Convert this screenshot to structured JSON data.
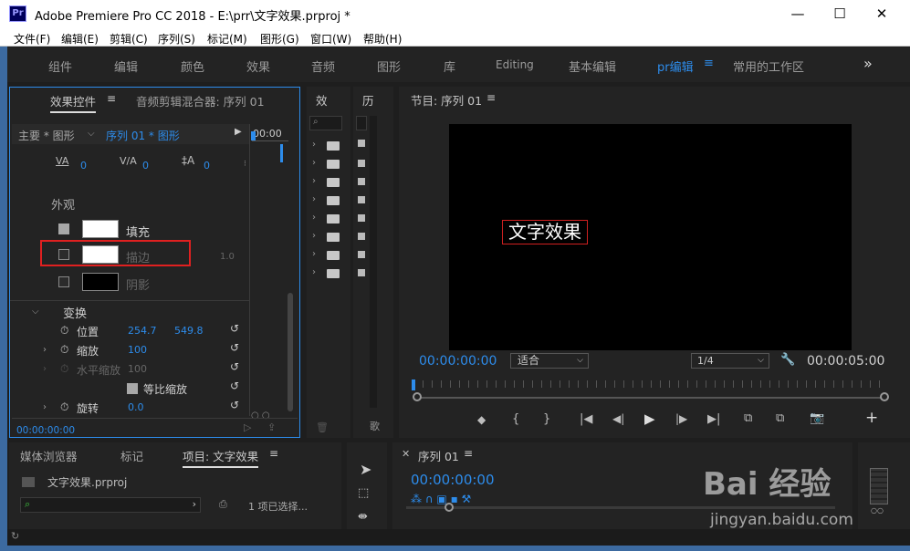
{
  "window": {
    "app_icon": "Pr",
    "title": "Adobe Premiere Pro CC 2018 - E:\\prr\\文字效果.prproj *",
    "min": "—",
    "max": "☐",
    "close": "✕"
  },
  "menu": [
    "文件(F)",
    "编辑(E)",
    "剪辑(C)",
    "序列(S)",
    "标记(M)",
    "图形(G)",
    "窗口(W)",
    "帮助(H)"
  ],
  "workspaces": [
    "组件",
    "编辑",
    "颜色",
    "效果",
    "音频",
    "图形",
    "库",
    "Editing",
    "基本编辑",
    "pr编辑",
    "常用的工作区"
  ],
  "workspace_active": "pr编辑",
  "effect_controls": {
    "tab": "效果控件",
    "tab2": "音频剪辑混合器: 序列 01",
    "source": "主要 * 图形",
    "sequence": "序列 01 * 图形",
    "timecode_head": "00:00",
    "tracking_val": "0",
    "kerning_val": "0",
    "leading_val": "0",
    "appearance": "外观",
    "fill_label": "填充",
    "stroke_label": "描边",
    "stroke_width": "1.0",
    "shadow_label": "阴影",
    "transform": "变换",
    "position_label": "位置",
    "pos_x": "254.7",
    "pos_y": "549.8",
    "scale_label": "缩放",
    "scale_val": "100",
    "hscale_label": "水平缩放",
    "hscale_val": "100",
    "uniform_label": "等比缩放",
    "rotation_label": "旋转",
    "rotation_val": "0.0",
    "footer_tc": "00:00:00:00"
  },
  "effects_panel": {
    "tab": "效",
    "history_tab": "历",
    "bottom_tab": "歌"
  },
  "program": {
    "title": "节目: 序列 01",
    "overlay_text": "文字效果",
    "timecode": "00:00:00:00",
    "fit": "适合",
    "res": "1/4",
    "duration": "00:00:05:00"
  },
  "project": {
    "tabs": [
      "媒体浏览器",
      "标记",
      "项目: 文字效果"
    ],
    "file": "文字效果.prproj",
    "selected": "1 项已选择..."
  },
  "timeline": {
    "title": "序列 01",
    "timecode": "00:00:00:00"
  },
  "colors": {
    "accent": "#2d8ceb",
    "highlight": "#e02020"
  },
  "watermark": {
    "brand": "Bai 经验",
    "url": "jingyan.baidu.com"
  }
}
